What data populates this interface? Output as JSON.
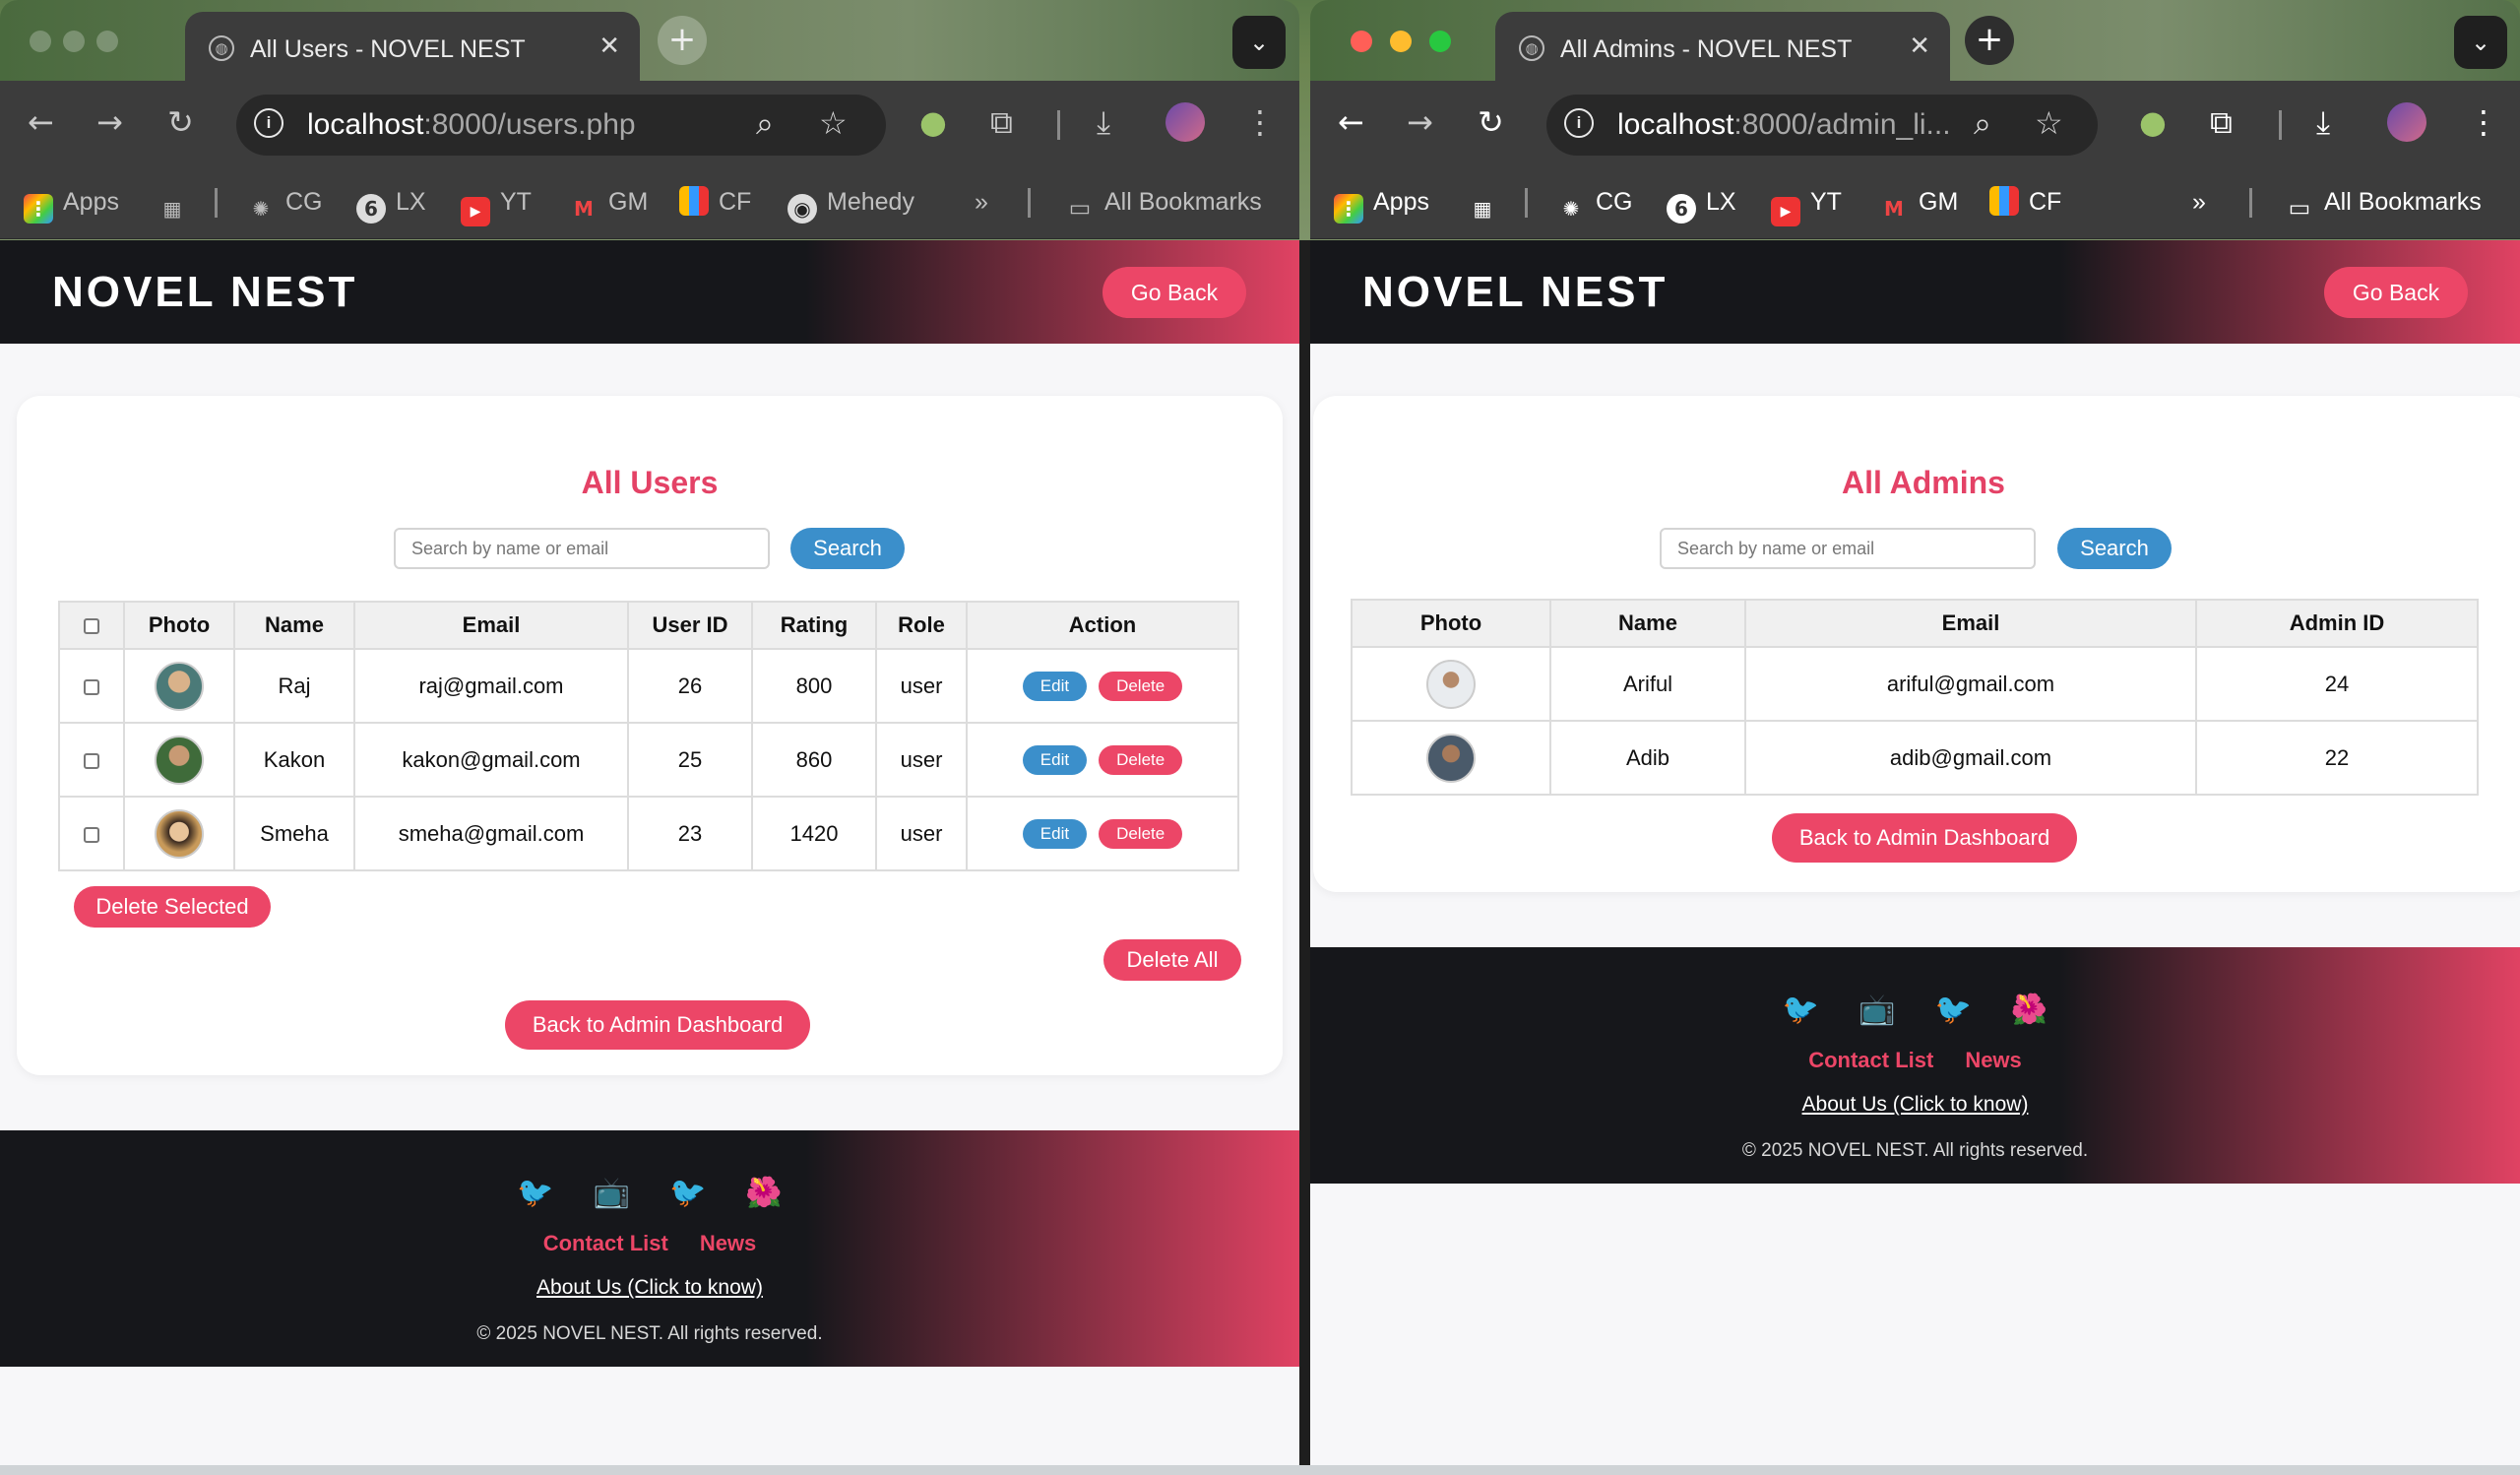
{
  "left_window": {
    "tab_title": "All Users - NOVEL NEST",
    "url_host": "localhost",
    "url_path": ":8000/users.php",
    "bookmarks": [
      "Apps",
      "CG",
      "LX",
      "YT",
      "GM",
      "CF",
      "Mehedy",
      "All Bookmarks"
    ],
    "brand": "NOVEL NEST",
    "go_back": "Go Back",
    "heading": "All Users",
    "search_placeholder": "Search by name or email",
    "search_button": "Search",
    "columns": [
      "Photo",
      "Name",
      "Email",
      "User ID",
      "Rating",
      "Role",
      "Action"
    ],
    "rows": [
      {
        "name": "Raj",
        "email": "raj@gmail.com",
        "id": "26",
        "rating": "800",
        "role": "user",
        "avatar_color": "#4b7a78"
      },
      {
        "name": "Kakon",
        "email": "kakon@gmail.com",
        "id": "25",
        "rating": "860",
        "role": "user",
        "avatar_color": "#3f6b3a"
      },
      {
        "name": "Smeha",
        "email": "smeha@gmail.com",
        "id": "23",
        "rating": "1420",
        "role": "user",
        "avatar_color": "#c89a5a"
      }
    ],
    "edit_label": "Edit",
    "delete_label": "Delete",
    "delete_selected": "Delete Selected",
    "delete_all": "Delete All",
    "back_dashboard": "Back to Admin Dashboard",
    "footer": {
      "icons": [
        "🐦",
        "📺",
        "🐦",
        "🌺"
      ],
      "contact": "Contact List",
      "news": "News",
      "about": "About Us (Click to know)",
      "copyright": "© 2025 NOVEL NEST. All rights reserved."
    }
  },
  "right_window": {
    "tab_title": "All Admins - NOVEL NEST",
    "url_host": "localhost",
    "url_path": ":8000/admin_li...",
    "bookmarks": [
      "Apps",
      "CG",
      "LX",
      "YT",
      "GM",
      "CF",
      "All Bookmarks"
    ],
    "brand": "NOVEL NEST",
    "go_back": "Go Back",
    "heading": "All Admins",
    "search_placeholder": "Search by name or email",
    "search_button": "Search",
    "columns": [
      "Photo",
      "Name",
      "Email",
      "Admin ID"
    ],
    "rows": [
      {
        "name": "Ariful",
        "email": "ariful@gmail.com",
        "id": "24",
        "avatar_color": "#e9ecef"
      },
      {
        "name": "Adib",
        "email": "adib@gmail.com",
        "id": "22",
        "avatar_color": "#4a5a6a"
      }
    ],
    "back_dashboard": "Back to Admin Dashboard",
    "footer": {
      "icons": [
        "🐦",
        "📺",
        "🐦",
        "🌺"
      ],
      "contact": "Contact List",
      "news": "News",
      "about": "About Us (Click to know)",
      "copyright": "© 2025 NOVEL NEST. All rights reserved."
    }
  },
  "colors": {
    "accent": "#ec4667",
    "heading": "#e44266",
    "button_blue": "#3b8fcb",
    "header_dark": "#16171b"
  }
}
